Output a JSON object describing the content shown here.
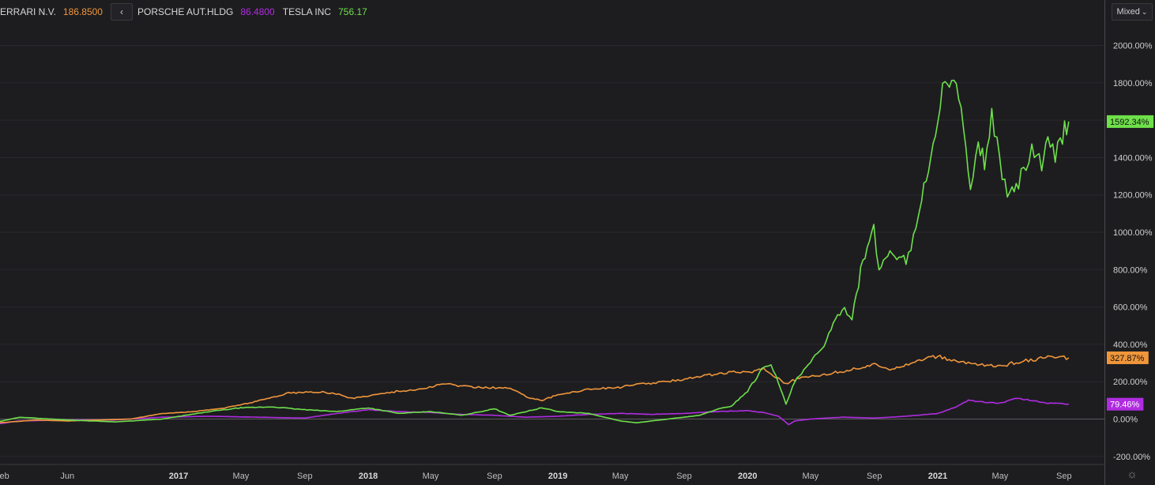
{
  "header": {
    "series1_name": "ERRARI N.V.",
    "series1_value": "186.8500",
    "nav_label": "‹",
    "series2_name": "PORSCHE AUT.HLDG",
    "series2_value": "86.4800",
    "series3_name": "TESLA INC",
    "series3_value": "756.17",
    "mode_label": "Mixed"
  },
  "colors": {
    "background": "#1d1d20",
    "ferrari": "#f0963a",
    "porsche": "#b02ce0",
    "tesla": "#6ee04a"
  },
  "icons": {
    "settings": "gear-icon",
    "nav": "chevron-left-icon",
    "dropdown": "chevron-down-icon"
  },
  "chart_data": {
    "type": "line",
    "y_unit": "%",
    "ylim": [
      -230,
      2230
    ],
    "y_ticks": [
      "2000.00%",
      "1800.00%",
      "1600.00%",
      "1400.00%",
      "1200.00%",
      "1000.00%",
      "800.00%",
      "600.00%",
      "400.00%",
      "200.00%",
      "0.00%",
      "-200.00%"
    ],
    "y_tick_values": [
      2000,
      1800,
      1600,
      1400,
      1200,
      1000,
      800,
      600,
      400,
      200,
      0,
      -200
    ],
    "x_ticks": [
      {
        "label": "eb",
        "date": "2016-02",
        "year": false
      },
      {
        "label": "Jun",
        "date": "2016-06",
        "year": false
      },
      {
        "label": "2017",
        "date": "2017-01",
        "year": true
      },
      {
        "label": "May",
        "date": "2017-05",
        "year": false
      },
      {
        "label": "Sep",
        "date": "2017-09",
        "year": false
      },
      {
        "label": "2018",
        "date": "2018-01",
        "year": true
      },
      {
        "label": "May",
        "date": "2018-05",
        "year": false
      },
      {
        "label": "Sep",
        "date": "2018-09",
        "year": false
      },
      {
        "label": "2019",
        "date": "2019-01",
        "year": true
      },
      {
        "label": "May",
        "date": "2019-05",
        "year": false
      },
      {
        "label": "Sep",
        "date": "2019-09",
        "year": false
      },
      {
        "label": "2020",
        "date": "2020-01",
        "year": true
      },
      {
        "label": "May",
        "date": "2020-05",
        "year": false
      },
      {
        "label": "Sep",
        "date": "2020-09",
        "year": false
      },
      {
        "label": "2021",
        "date": "2021-01",
        "year": true
      },
      {
        "label": "May",
        "date": "2021-05",
        "year": false
      },
      {
        "label": "Sep",
        "date": "2021-09",
        "year": false
      }
    ],
    "series": [
      {
        "key": "ferrari",
        "color": "#f0963a",
        "last_label": "327.87%",
        "last_value": 327.87,
        "points": [
          [
            "2016-01-20",
            -20
          ],
          [
            "2016-02-15",
            -15
          ],
          [
            "2016-04",
            -5
          ],
          [
            "2016-06",
            -10
          ],
          [
            "2016-08",
            -5
          ],
          [
            "2016-10",
            0
          ],
          [
            "2016-12",
            30
          ],
          [
            "2017-02",
            40
          ],
          [
            "2017-04",
            60
          ],
          [
            "2017-06",
            95
          ],
          [
            "2017-08",
            140
          ],
          [
            "2017-10",
            145
          ],
          [
            "2017-11",
            135
          ],
          [
            "2017-12",
            110
          ],
          [
            "2018-01",
            125
          ],
          [
            "2018-03",
            150
          ],
          [
            "2018-04",
            155
          ],
          [
            "2018-06",
            190
          ],
          [
            "2018-07",
            175
          ],
          [
            "2018-08",
            170
          ],
          [
            "2018-10",
            165
          ],
          [
            "2018-11",
            120
          ],
          [
            "2018-12",
            100
          ],
          [
            "2019-01",
            130
          ],
          [
            "2019-03",
            160
          ],
          [
            "2019-05",
            170
          ],
          [
            "2019-06",
            185
          ],
          [
            "2019-08",
            200
          ],
          [
            "2019-10",
            230
          ],
          [
            "2019-12",
            250
          ],
          [
            "2020-01",
            250
          ],
          [
            "2020-02",
            270
          ],
          [
            "2020-03-15",
            190
          ],
          [
            "2020-04",
            210
          ],
          [
            "2020-05",
            230
          ],
          [
            "2020-06",
            240
          ],
          [
            "2020-07",
            255
          ],
          [
            "2020-09",
            290
          ],
          [
            "2020-10",
            270
          ],
          [
            "2020-11",
            290
          ],
          [
            "2020-12",
            320
          ],
          [
            "2021-01",
            335
          ],
          [
            "2021-02",
            310
          ],
          [
            "2021-03",
            300
          ],
          [
            "2021-04",
            290
          ],
          [
            "2021-05",
            280
          ],
          [
            "2021-06",
            305
          ],
          [
            "2021-08",
            330
          ],
          [
            "2021-09-10",
            327.87
          ]
        ]
      },
      {
        "key": "porsche",
        "color": "#b02ce0",
        "last_label": "79.46%",
        "last_value": 79.46,
        "points": [
          [
            "2016-01-20",
            -25
          ],
          [
            "2016-03",
            -10
          ],
          [
            "2016-06",
            -5
          ],
          [
            "2016-09",
            -5
          ],
          [
            "2016-12",
            10
          ],
          [
            "2017-03",
            15
          ],
          [
            "2017-06",
            10
          ],
          [
            "2017-09",
            5
          ],
          [
            "2017-11",
            30
          ],
          [
            "2018-01",
            50
          ],
          [
            "2018-03",
            40
          ],
          [
            "2018-05",
            35
          ],
          [
            "2018-07",
            25
          ],
          [
            "2018-09",
            20
          ],
          [
            "2018-11",
            10
          ],
          [
            "2019-01",
            15
          ],
          [
            "2019-03",
            25
          ],
          [
            "2019-05",
            30
          ],
          [
            "2019-07",
            25
          ],
          [
            "2019-09",
            30
          ],
          [
            "2019-11",
            40
          ],
          [
            "2020-01",
            45
          ],
          [
            "2020-02",
            35
          ],
          [
            "2020-03",
            15
          ],
          [
            "2020-03-20",
            -30
          ],
          [
            "2020-04",
            -10
          ],
          [
            "2020-05",
            0
          ],
          [
            "2020-07",
            10
          ],
          [
            "2020-09",
            5
          ],
          [
            "2020-11",
            15
          ],
          [
            "2021-01",
            30
          ],
          [
            "2021-02",
            60
          ],
          [
            "2021-03",
            100
          ],
          [
            "2021-04",
            90
          ],
          [
            "2021-05",
            85
          ],
          [
            "2021-06",
            110
          ],
          [
            "2021-07",
            100
          ],
          [
            "2021-08",
            85
          ],
          [
            "2021-09-10",
            79.46
          ]
        ]
      },
      {
        "key": "tesla",
        "color": "#6ee04a",
        "last_label": "1592.34%",
        "last_value": 1592.34,
        "points": [
          [
            "2016-01-20",
            -15
          ],
          [
            "2016-03",
            10
          ],
          [
            "2016-06",
            -5
          ],
          [
            "2016-09",
            -15
          ],
          [
            "2016-12",
            0
          ],
          [
            "2017-03",
            40
          ],
          [
            "2017-05",
            60
          ],
          [
            "2017-07",
            65
          ],
          [
            "2017-09",
            50
          ],
          [
            "2017-11",
            40
          ],
          [
            "2018-01",
            60
          ],
          [
            "2018-03",
            30
          ],
          [
            "2018-05",
            40
          ],
          [
            "2018-07",
            20
          ],
          [
            "2018-09",
            55
          ],
          [
            "2018-10",
            20
          ],
          [
            "2018-12",
            60
          ],
          [
            "2019-01",
            40
          ],
          [
            "2019-03",
            30
          ],
          [
            "2019-05",
            -10
          ],
          [
            "2019-06",
            -20
          ],
          [
            "2019-08",
            0
          ],
          [
            "2019-10",
            20
          ],
          [
            "2019-11",
            50
          ],
          [
            "2019-12",
            70
          ],
          [
            "2020-01",
            150
          ],
          [
            "2020-02",
            280
          ],
          [
            "2020-02-15",
            300
          ],
          [
            "2020-03-15",
            80
          ],
          [
            "2020-04",
            200
          ],
          [
            "2020-05",
            300
          ],
          [
            "2020-06",
            420
          ],
          [
            "2020-07",
            600
          ],
          [
            "2020-07-20",
            550
          ],
          [
            "2020-08-10",
            850
          ],
          [
            "2020-08-31",
            1010
          ],
          [
            "2020-09-10",
            800
          ],
          [
            "2020-10",
            900
          ],
          [
            "2020-11",
            850
          ],
          [
            "2020-11-20",
            1000
          ],
          [
            "2020-12",
            1200
          ],
          [
            "2021-01",
            1550
          ],
          [
            "2021-01-15",
            1870
          ],
          [
            "2021-02",
            1800
          ],
          [
            "2021-02-15",
            1650
          ],
          [
            "2021-03-05",
            1200
          ],
          [
            "2021-03-20",
            1450
          ],
          [
            "2021-04",
            1380
          ],
          [
            "2021-04-15",
            1620
          ],
          [
            "2021-05-05",
            1300
          ],
          [
            "2021-05-20",
            1180
          ],
          [
            "2021-06",
            1250
          ],
          [
            "2021-06-20",
            1350
          ],
          [
            "2021-07",
            1450
          ],
          [
            "2021-07-20",
            1350
          ],
          [
            "2021-08",
            1480
          ],
          [
            "2021-08-15",
            1400
          ],
          [
            "2021-08-25",
            1500
          ],
          [
            "2021-09-10",
            1592.34
          ]
        ]
      }
    ]
  }
}
